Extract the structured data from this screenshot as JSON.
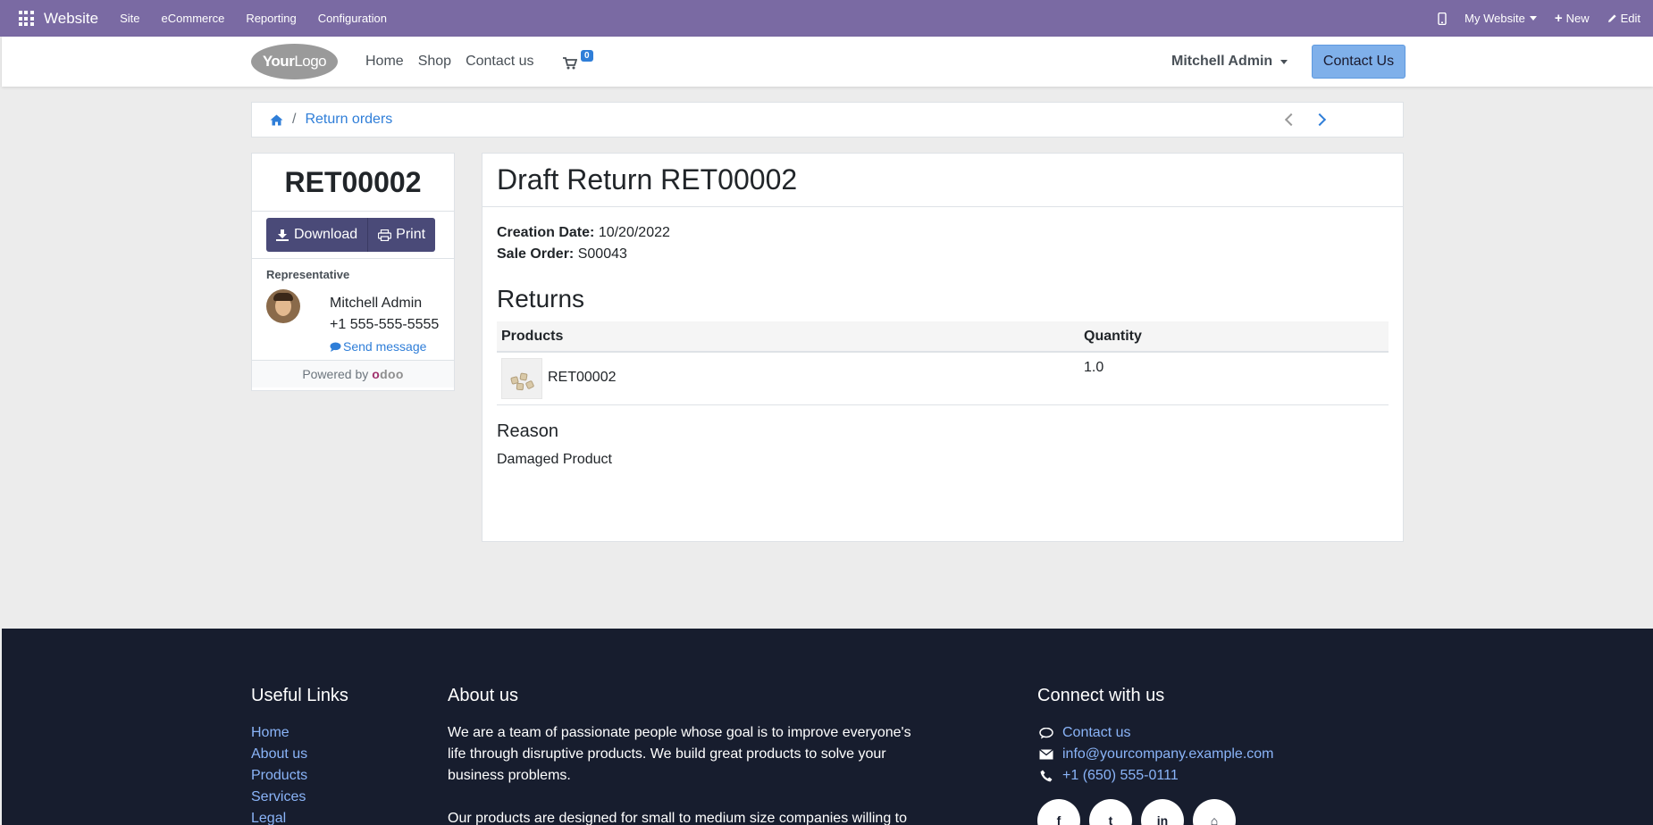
{
  "adminbar": {
    "brand": "Website",
    "menu": [
      "Site",
      "eCommerce",
      "Reporting",
      "Configuration"
    ],
    "right": {
      "website": "My Website",
      "new": "New",
      "edit": "Edit"
    }
  },
  "header": {
    "logo": {
      "bold": "Your",
      "rest": "Logo"
    },
    "nav": [
      "Home",
      "Shop",
      "Contact us"
    ],
    "cart_count": "0",
    "user": "Mitchell Admin",
    "contact_button": "Contact Us"
  },
  "breadcrumb": {
    "current": "Return orders"
  },
  "sidebar": {
    "reference": "RET00002",
    "download": "Download",
    "print": "Print",
    "rep_label": "Representative",
    "rep_name": "Mitchell Admin",
    "rep_phone": "+1 555-555-5555",
    "send_message": "Send message",
    "powered_by": "Powered by",
    "odoo": "odoo"
  },
  "main": {
    "title": "Draft Return RET00002",
    "creation_label": "Creation Date:",
    "creation_date": "10/20/2022",
    "sale_label": "Sale Order:",
    "sale_order": "S00043",
    "returns_heading": "Returns",
    "columns": [
      "Products",
      "Quantity"
    ],
    "rows": [
      {
        "product": "RET00002",
        "quantity": "1.0"
      }
    ],
    "reason_heading": "Reason",
    "reason": "Damaged Product"
  },
  "footer": {
    "useful_links_title": "Useful Links",
    "useful_links": [
      "Home",
      "About us",
      "Products",
      "Services",
      "Legal"
    ],
    "about_title": "About us",
    "about_p1": "We are a team of passionate people whose goal is to improve everyone's life through disruptive products. We build great products to solve your business problems.",
    "about_p2": "Our products are designed for small to medium size companies willing to",
    "connect_title": "Connect with us",
    "contact_us": "Contact us",
    "email": "info@yourcompany.example.com",
    "phone": "+1 (650) 555-0111"
  }
}
